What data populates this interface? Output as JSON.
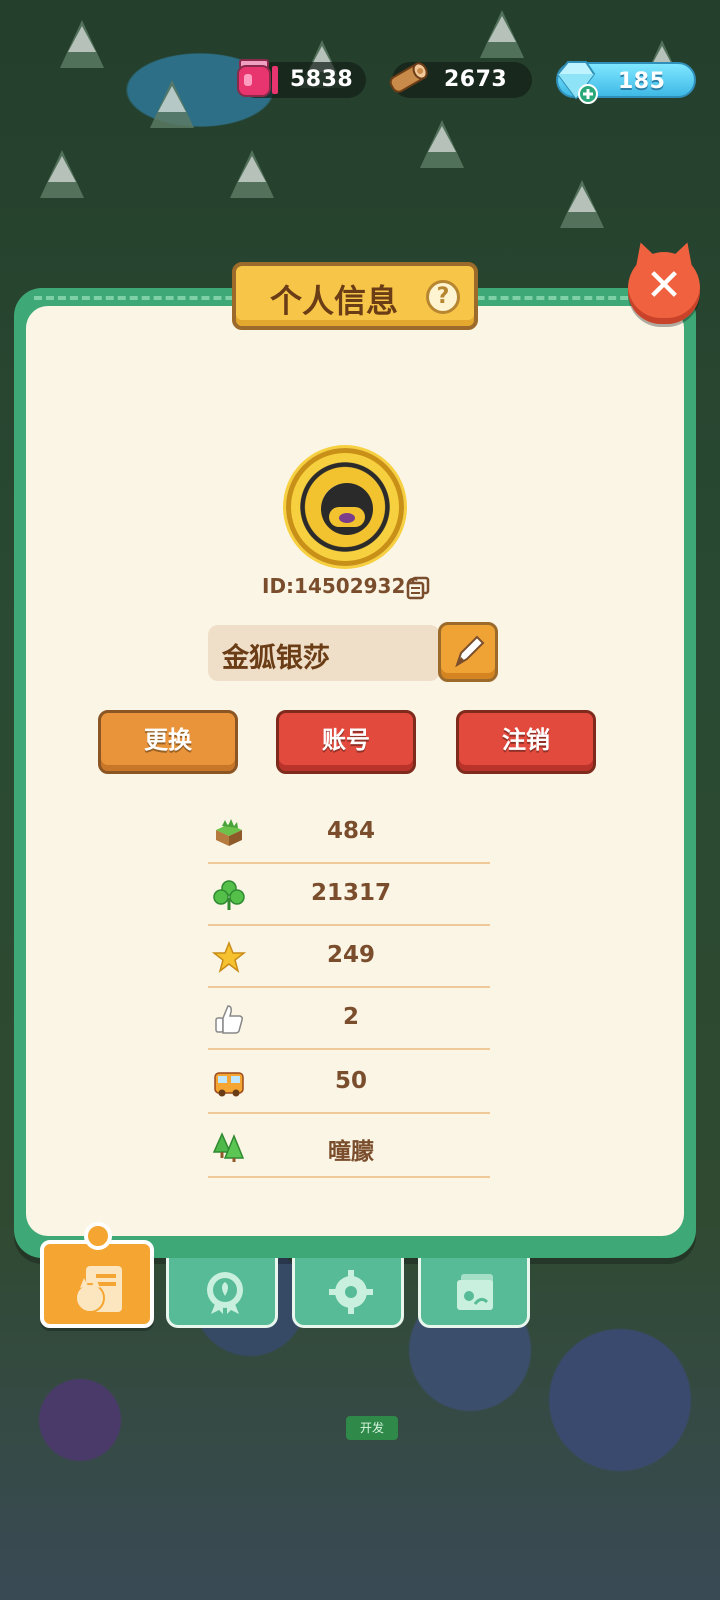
{
  "resources": {
    "jam": "5838",
    "wood": "2673",
    "gems": "185"
  },
  "panel": {
    "title": "个人信息",
    "help_glyph": "?",
    "close_glyph": "✕"
  },
  "profile": {
    "id_text": "ID:145029326",
    "name": "金狐银莎"
  },
  "actions": {
    "switch_label": "更换",
    "account_label": "账号",
    "logout_label": "注销"
  },
  "stats": [
    {
      "icon": "land-block-icon",
      "value": "484"
    },
    {
      "icon": "clover-icon",
      "value": "21317"
    },
    {
      "icon": "star-icon",
      "value": "249"
    },
    {
      "icon": "thumbs-up-icon",
      "value": "2"
    },
    {
      "icon": "bus-icon",
      "value": "50"
    },
    {
      "icon": "forest-icon",
      "value": "曈朦"
    }
  ],
  "tabs": [
    "profile",
    "achievements",
    "settings",
    "album"
  ],
  "background_label": "开发",
  "colors": {
    "panel_border": "#3fa877",
    "panel_bg": "#fbf5e6",
    "title_plate": "#f7c548",
    "accent_orange": "#e9943a",
    "accent_red": "#e24a3d",
    "text_brown": "#7a4e2c"
  }
}
